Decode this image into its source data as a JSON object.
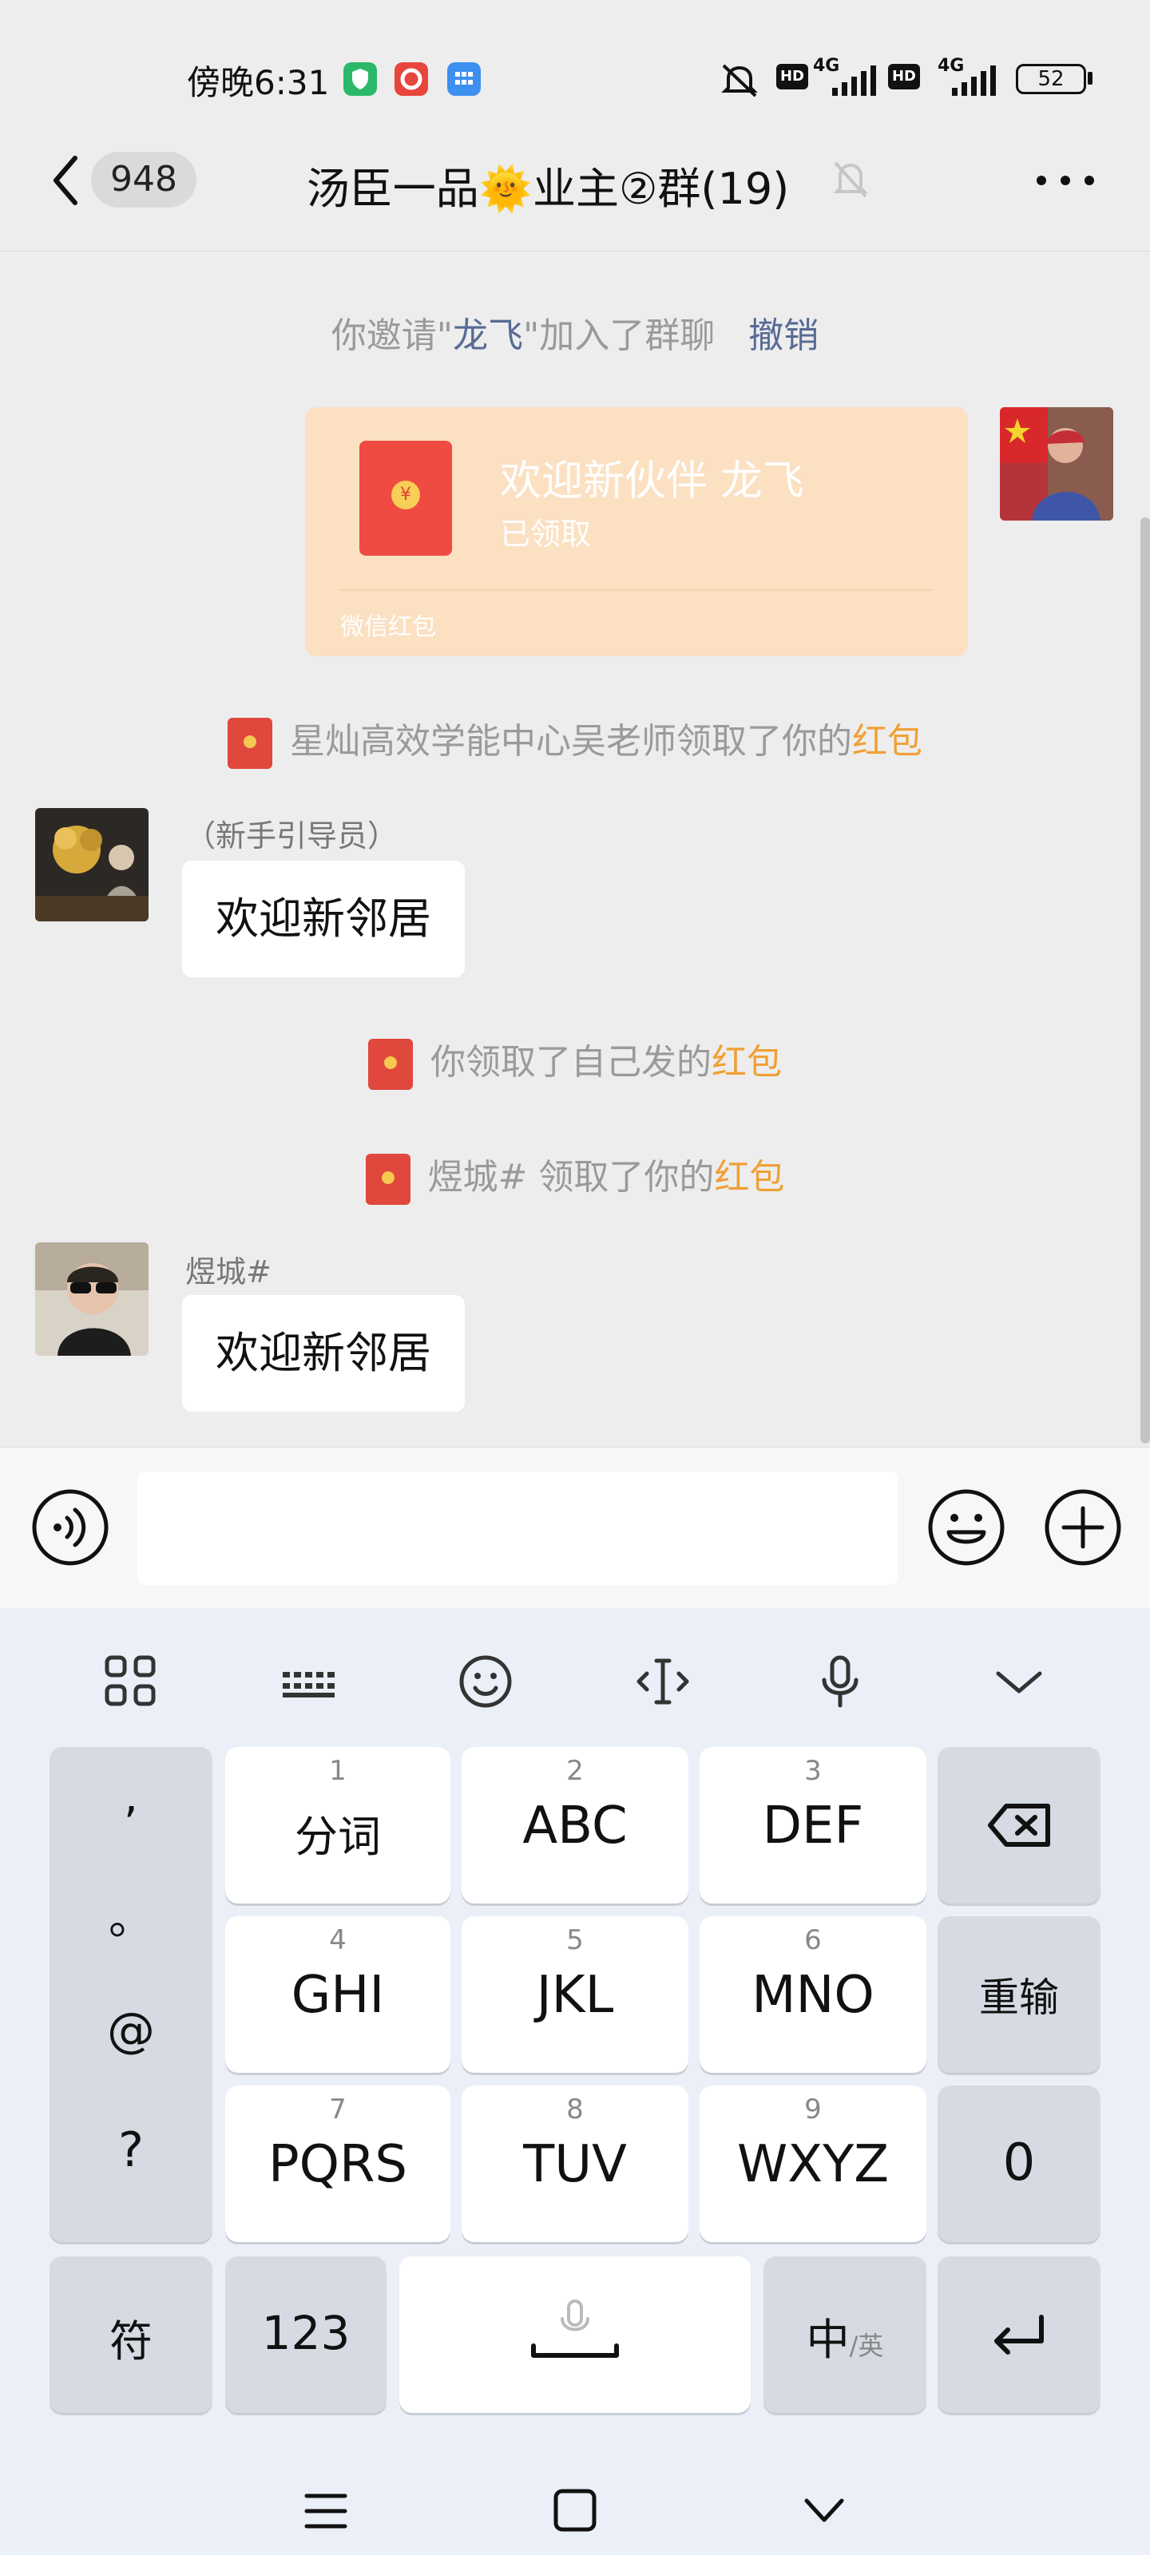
{
  "status_bar": {
    "time": "傍晚6:31",
    "hd1": "HD",
    "net1": "4G",
    "hd2": "HD",
    "net2": "4G",
    "battery": "52"
  },
  "header": {
    "unread_count": "948",
    "title": "汤臣一品🌞业主②群(19)"
  },
  "messages": {
    "invite": {
      "prefix": "你邀请\"",
      "name": "龙飞",
      "suffix": "\"加入了群聊",
      "action": "撤销"
    },
    "red_packet": {
      "title": "欢迎新伙伴  龙飞",
      "status": "已领取",
      "footer": "微信红包",
      "coin": "¥"
    },
    "claim1": {
      "text": "星灿高效学能中心吴老师领取了你的",
      "link": "红包"
    },
    "msg1": {
      "sender": "（新手引导员）",
      "text": "欢迎新邻居"
    },
    "claim2": {
      "text": "你领取了自己发的",
      "link": "红包"
    },
    "claim3": {
      "text": "煜城#  领取了你的",
      "link": "红包"
    },
    "msg2": {
      "sender": "煜城#",
      "text": "欢迎新邻居"
    }
  },
  "keyboard": {
    "left_col": [
      ",",
      "。",
      "@",
      "?"
    ],
    "keys": [
      {
        "num": "1",
        "label": "分词"
      },
      {
        "num": "2",
        "label": "ABC"
      },
      {
        "num": "3",
        "label": "DEF"
      },
      {
        "num": "4",
        "label": "GHI"
      },
      {
        "num": "5",
        "label": "JKL"
      },
      {
        "num": "6",
        "label": "MNO"
      },
      {
        "num": "7",
        "label": "PQRS"
      },
      {
        "num": "8",
        "label": "TUV"
      },
      {
        "num": "9",
        "label": "WXYZ"
      }
    ],
    "reenter": "重输",
    "zero": "0",
    "symbols": "符",
    "num123": "123",
    "lang_main": "中",
    "lang_sub": "/英"
  },
  "colors": {
    "accent_orange": "#f0a036",
    "link_blue": "#576b95",
    "red_packet_bg": "#fbe0c2",
    "red_packet_icon": "#ef4b42"
  }
}
